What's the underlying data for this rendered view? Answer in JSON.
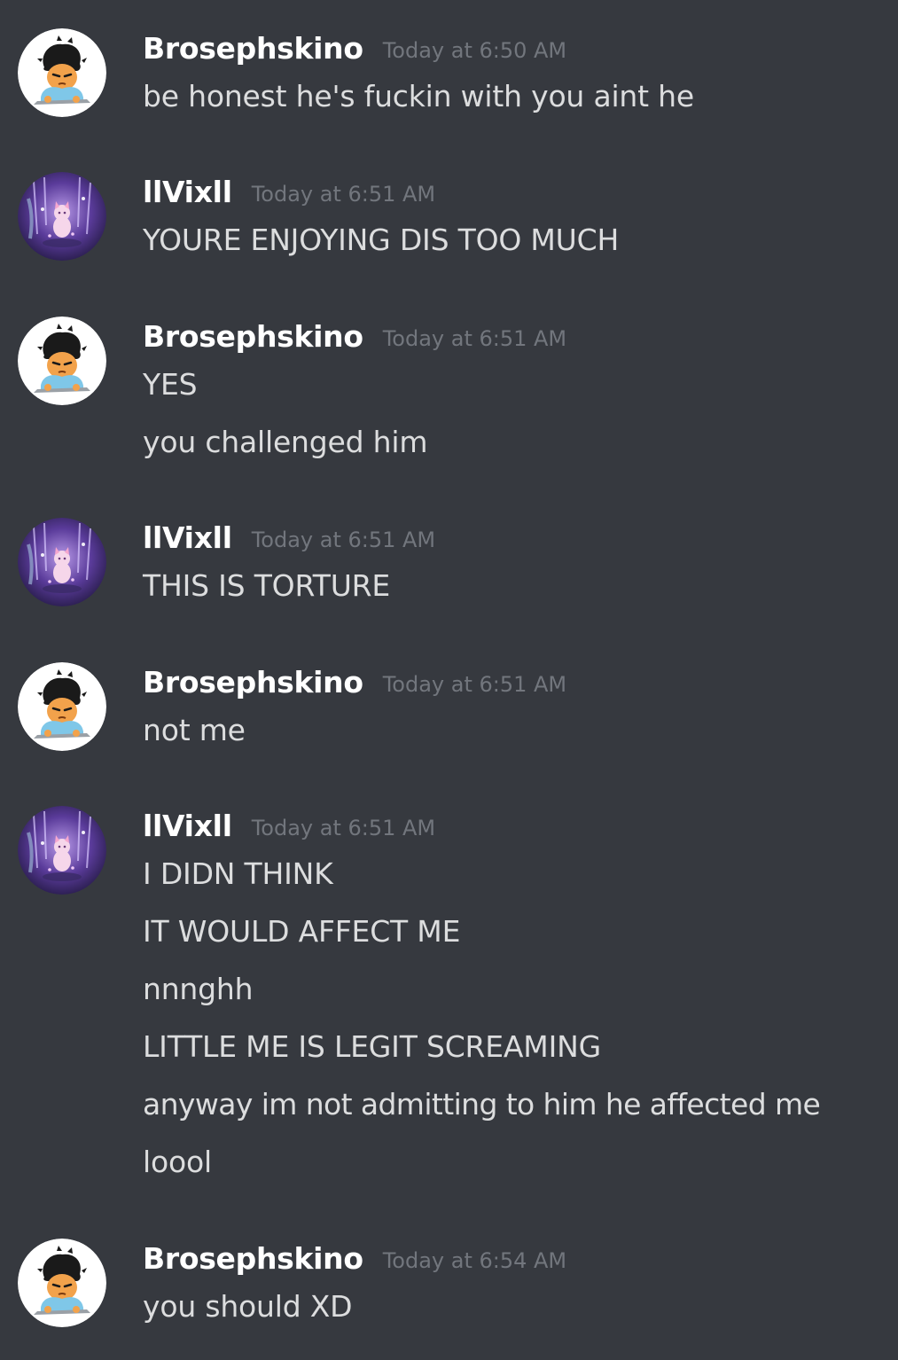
{
  "colors": {
    "background": "#36393f",
    "username": "#ffffff",
    "timestamp": "#72767d",
    "message_text": "#dcddde"
  },
  "messages": [
    {
      "author": "Brosephskino",
      "avatar": "cartoon-boy-avatar-icon",
      "timestamp": "Today at 6:50 AM",
      "lines": [
        "be honest he's fuckin with you aint he"
      ]
    },
    {
      "author": "llVixll",
      "avatar": "purple-forest-cat-avatar-icon",
      "timestamp": "Today at 6:51 AM",
      "lines": [
        "YOURE ENJOYING DIS TOO MUCH"
      ]
    },
    {
      "author": "Brosephskino",
      "avatar": "cartoon-boy-avatar-icon",
      "timestamp": "Today at 6:51 AM",
      "lines": [
        "YES",
        "you challenged him"
      ]
    },
    {
      "author": "llVixll",
      "avatar": "purple-forest-cat-avatar-icon",
      "timestamp": "Today at 6:51 AM",
      "lines": [
        "THIS IS TORTURE"
      ]
    },
    {
      "author": "Brosephskino",
      "avatar": "cartoon-boy-avatar-icon",
      "timestamp": "Today at 6:51 AM",
      "lines": [
        "not me"
      ]
    },
    {
      "author": "llVixll",
      "avatar": "purple-forest-cat-avatar-icon",
      "timestamp": "Today at 6:51 AM",
      "lines": [
        "I DIDN THINK",
        "IT WOULD AFFECT ME",
        "nnnghh",
        "LITTLE ME IS LEGIT SCREAMING",
        "anyway im not admitting to him he affected me",
        "loool"
      ]
    },
    {
      "author": "Brosephskino",
      "avatar": "cartoon-boy-avatar-icon",
      "timestamp": "Today at 6:54 AM",
      "lines": [
        "you should XD"
      ]
    }
  ]
}
